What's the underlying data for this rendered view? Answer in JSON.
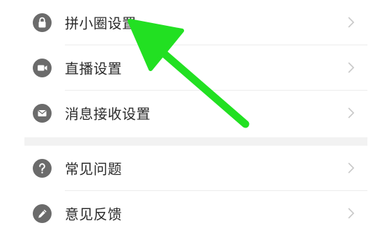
{
  "settings_group_1": {
    "items": [
      {
        "label": "拼小圈设置",
        "icon": "lock-icon"
      },
      {
        "label": "直播设置",
        "icon": "video-camera-icon"
      },
      {
        "label": "消息接收设置",
        "icon": "mail-icon"
      }
    ]
  },
  "settings_group_2": {
    "items": [
      {
        "label": "常见问题",
        "icon": "question-icon"
      },
      {
        "label": "意见反馈",
        "icon": "pencil-icon"
      }
    ]
  },
  "colors": {
    "icon_bg": "#6b6b6b",
    "text": "#2a2a2a",
    "chevron": "#c8c8c8",
    "section_gap": "#f2f2f2",
    "annotation_arrow": "#22e022"
  },
  "annotation": {
    "type": "arrow",
    "target": "拼小圈设置"
  }
}
